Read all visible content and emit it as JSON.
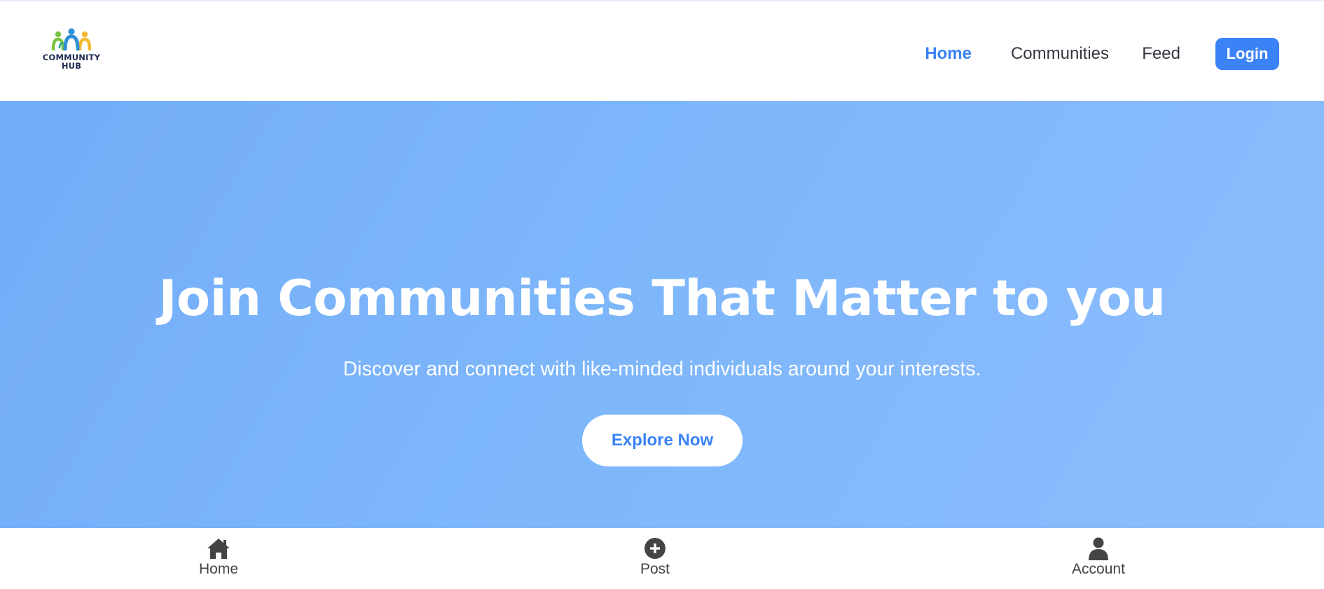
{
  "header": {
    "logo": {
      "icon": "community-people-icon",
      "line1": "COMMUNITY",
      "line2": "HUB"
    },
    "nav": {
      "home": "Home",
      "communities": "Communities",
      "feed": "Feed",
      "login": "Login"
    }
  },
  "hero": {
    "title": "Join Communities That Matter to you",
    "subtitle": "Discover and connect with like-minded individuals around your interests.",
    "cta": "Explore Now"
  },
  "bottom_nav": {
    "items": [
      {
        "label": "Home",
        "icon": "home-icon"
      },
      {
        "label": "Post",
        "icon": "plus-circle-icon"
      },
      {
        "label": "Account",
        "icon": "user-icon"
      }
    ]
  },
  "colors": {
    "accent": "#3b82f6",
    "hero_bg": "#7db6fa",
    "text_dark": "#333740",
    "logo_green": "#7cc242",
    "logo_blue": "#2d8fd5",
    "logo_yellow": "#f5b82e"
  }
}
